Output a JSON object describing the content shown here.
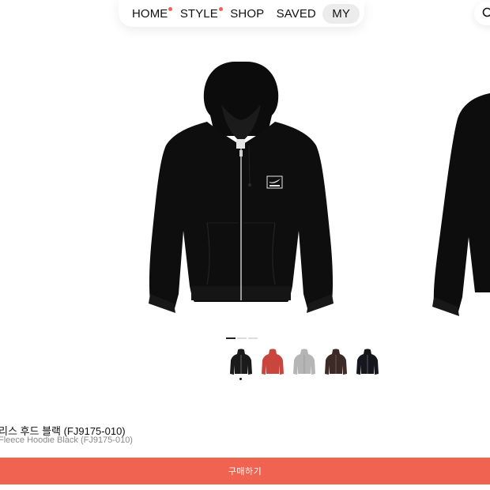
{
  "nav": {
    "items": [
      {
        "label": "HOME",
        "has_dot": true
      },
      {
        "label": "STYLE",
        "has_dot": true
      },
      {
        "label": "SHOP",
        "has_dot": false
      },
      {
        "label": "SAVED",
        "has_dot": false
      },
      {
        "label": "MY",
        "has_dot": false,
        "active": true
      }
    ],
    "search_icon": "search-icon"
  },
  "gallery": {
    "active_index": 0,
    "page_count": 3,
    "main_image_icon": "black-zip-hoodie",
    "swatches": [
      {
        "color_name": "black",
        "color": "#1a1a1a",
        "selected": true
      },
      {
        "color_name": "red",
        "color": "#c8463e",
        "selected": false
      },
      {
        "color_name": "grey",
        "color": "#b5b5b5",
        "selected": false
      },
      {
        "color_name": "brown",
        "color": "#3b2a26",
        "selected": false
      },
      {
        "color_name": "black-alt",
        "color": "#15171c",
        "selected": false
      }
    ]
  },
  "product": {
    "name_ko": "리스 후드 블랙 (FJ9175-010)",
    "name_en": "Fleece Hoodie Black (FJ9175-010)"
  },
  "cta": {
    "buy_label": "구매하기"
  },
  "colors": {
    "accent": "#ef6350",
    "nav_active_bg": "#ececec"
  }
}
